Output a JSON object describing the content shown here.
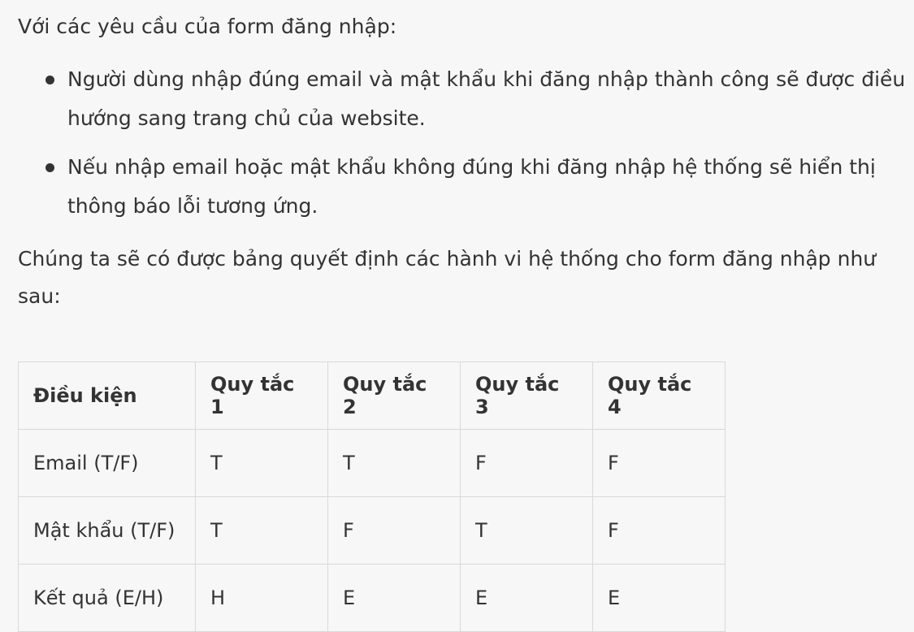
{
  "intro": "Với các yêu cầu của form đăng nhập:",
  "bullets": [
    "Người dùng nhập đúng email và mật khẩu khi đăng nhập thành công sẽ được điều hướng sang trang chủ của website.",
    "Nếu nhập email hoặc mật khẩu không đúng khi đăng nhập hệ thống sẽ hiển thị thông báo lỗi tương ứng."
  ],
  "summary": "Chúng ta sẽ có được bảng quyết định các hành vi hệ thống cho form đăng nhập như sau:",
  "table": {
    "headers": [
      "Điều kiện",
      "Quy tắc 1",
      "Quy tắc 2",
      "Quy tắc 3",
      "Quy tắc 4"
    ],
    "rows": [
      [
        "Email (T/F)",
        "T",
        "T",
        "F",
        "F"
      ],
      [
        "Mật khẩu (T/F)",
        "T",
        "F",
        "T",
        "F"
      ],
      [
        "Kết quả (E/H)",
        "H",
        "E",
        "E",
        "E"
      ]
    ]
  }
}
